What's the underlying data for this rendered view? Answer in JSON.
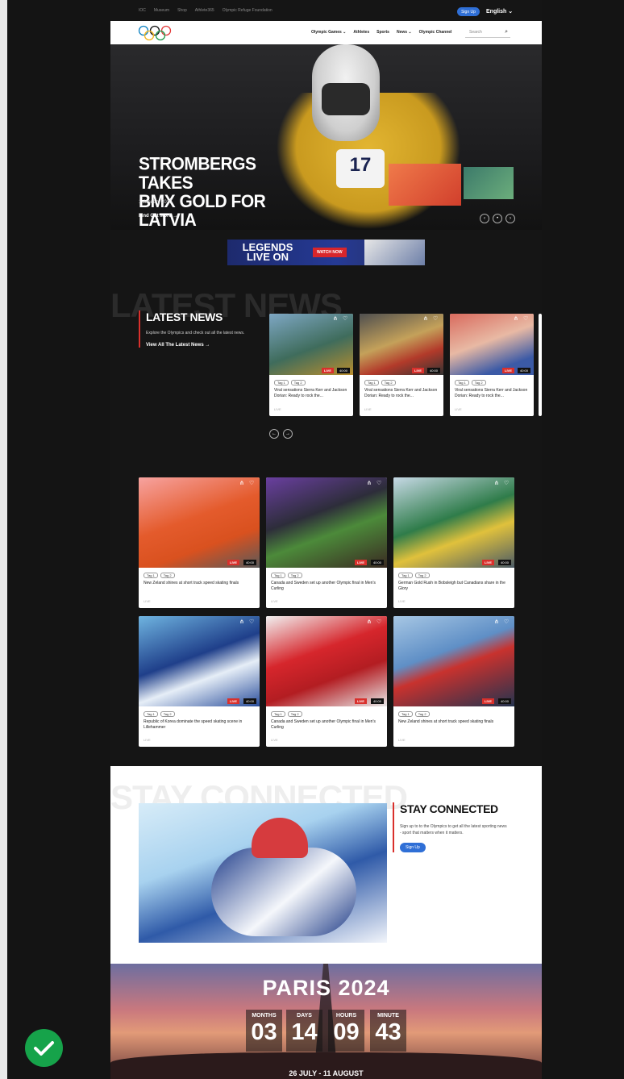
{
  "utility_bar": {
    "links": [
      "IOC",
      "Museum",
      "Shop",
      "Athlete365",
      "Olympic Refuge Foundation"
    ],
    "signup": "Sign Up",
    "language": "English ⌄"
  },
  "nav": {
    "links": [
      "Olympic Games ⌄",
      "Athletes",
      "Sports",
      "News ⌄",
      "Olympic Channel"
    ],
    "search_placeholder": "Search"
  },
  "hero": {
    "title_line1": "STROMBERGS TAKES",
    "title_line2": "BMX GOLD FOR LATVIA",
    "date": "1 January 2020",
    "link": "Find Out More →",
    "plate_number": "17"
  },
  "banner": {
    "line1": "LEGENDS",
    "line2": "LIVE ON",
    "button": "WATCH NOW"
  },
  "latest_news": {
    "ghost": "LATEST NEWS",
    "title": "LATEST NEWS",
    "description": "Explore the Olympics and check out all the latest news.",
    "link": "View All The Latest News →",
    "cards": [
      {
        "tag1": "Tag 1",
        "tag2": "Tag 2",
        "title": "Viral sensations Sierra Kerr and Jackson Dorian: Ready to rock the...",
        "meta": "LIVE",
        "live": "LIVE",
        "dur": "40:00"
      },
      {
        "tag1": "Tag 1",
        "tag2": "Tag 2",
        "title": "Viral sensations Sierra Kerr and Jackson Dorian: Ready to rock the...",
        "meta": "LIVE",
        "live": "LIVE",
        "dur": "40:00"
      },
      {
        "tag1": "Tag 1",
        "tag2": "Tag 2",
        "title": "Viral sensations Sierra Kerr and Jackson Dorian: Ready to rock the...",
        "meta": "LIVE",
        "live": "LIVE",
        "dur": "40:00"
      }
    ]
  },
  "grid": {
    "cards": [
      {
        "tag1": "Tag 1",
        "tag2": "Tag 2",
        "title": "New Zeland shines at short track speed skating finals",
        "meta": "LIVE",
        "live": "LIVE",
        "dur": "40:00"
      },
      {
        "tag1": "Tag 1",
        "tag2": "Tag 2",
        "title": "Canada and Sweden set up another Olympic final in Men's Curling",
        "meta": "LIVE",
        "live": "LIVE",
        "dur": "40:00"
      },
      {
        "tag1": "Tag 1",
        "tag2": "Tag 2",
        "title": "German Gold Rush in Bobsleigh but Canadians share in the Glory",
        "meta": "LIVE",
        "live": "LIVE",
        "dur": "40:00"
      },
      {
        "tag1": "Tag 1",
        "tag2": "Tag 2",
        "title": "Republic of Korea dominate the speed skating scene in Lillehammer",
        "meta": "LIVE",
        "live": "LIVE",
        "dur": "40:00"
      },
      {
        "tag1": "Tag 1",
        "tag2": "Tag 2",
        "title": "Canada and Sweden set up another Olympic final in Men's Curling",
        "meta": "LIVE",
        "live": "LIVE",
        "dur": "40:00"
      },
      {
        "tag1": "Tag 1",
        "tag2": "Tag 2",
        "title": "New Zeland shines at short track speed skating finals",
        "meta": "LIVE",
        "live": "LIVE",
        "dur": "40:00"
      }
    ]
  },
  "stay_connected": {
    "ghost": "STAY CONNECTED",
    "title": "STAY CONNECTED",
    "description": "Sign up to to the Olympics to get all the latest sporting news - sport that matters when it matters.",
    "button": "Sign Up"
  },
  "paris": {
    "title": "PARIS 2024",
    "countdown": [
      {
        "label": "MONTHS",
        "value": "03"
      },
      {
        "label": "DAYS",
        "value": "14"
      },
      {
        "label": "HOURS",
        "value": "09"
      },
      {
        "label": "MINUTE",
        "value": "43"
      }
    ],
    "dates": "26 JULY - 11 AUGUST"
  },
  "colors": {
    "accent_red": "#d9302c",
    "accent_blue": "#2f6fd6",
    "status_green": "#16a34a"
  },
  "icons": [
    "search-icon",
    "share-icon",
    "heart-icon",
    "arrow-left-icon",
    "arrow-right-icon",
    "check-icon",
    "olympic-rings-logo"
  ]
}
